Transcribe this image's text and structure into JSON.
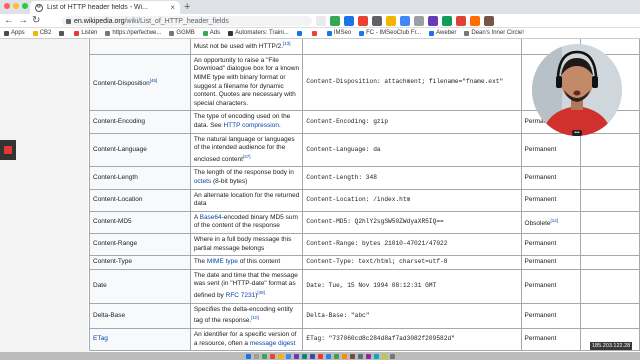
{
  "browser": {
    "tab_title": "List of HTTP header fields - Wi...",
    "favicon_glyph": "W",
    "close_glyph": "×",
    "newtab_glyph": "+",
    "url_host": "en.wikipedia.org",
    "url_path": "/wiki/List_of_HTTP_header_fields",
    "back_glyph": "←",
    "forward_glyph": "→",
    "reload_glyph": "↻"
  },
  "bookmarks": [
    {
      "label": "Apps",
      "color": "#4a4a4a"
    },
    {
      "label": "CB2",
      "color": "#f4b400"
    },
    {
      "label": "",
      "color": "#555"
    },
    {
      "label": "Listen",
      "color": "#e53935"
    },
    {
      "label": "https://perfectwe...",
      "color": "#777"
    },
    {
      "label": "GGMB",
      "color": "#777"
    },
    {
      "label": "Ads",
      "color": "#34a853"
    },
    {
      "label": "Automaters: Traini...",
      "color": "#333"
    },
    {
      "label": "",
      "color": "#1a73e8"
    },
    {
      "label": "",
      "color": "#ea4335"
    },
    {
      "label": "IMSeo",
      "color": "#1a73e8"
    },
    {
      "label": "FC - IMSeoClub Fr...",
      "color": "#1877f2"
    },
    {
      "label": "Aweber",
      "color": "#1a73e8"
    },
    {
      "label": "Dean's Inner Circle!",
      "color": "#777"
    }
  ],
  "rows": [
    {
      "name": "",
      "desc": "Must not be used with HTTP/2.",
      "desc_sup": "[13]",
      "example": "",
      "status": ""
    },
    {
      "name": "Content-Disposition",
      "name_sup": "[46]",
      "desc": "An opportunity to raise a \"File Download\" dialogue box for a known MIME type with binary format or suggest a filename for dynamic content. Quotes are necessary with special characters.",
      "example": "Content-Disposition: attachment; filename=\"fname.ext\"",
      "status": ""
    },
    {
      "name": "Content-Encoding",
      "desc_pre": "The type of encoding used on the data. See ",
      "desc_link": "HTTP compression",
      "desc_post": ".",
      "example": "Content-Encoding: gzip",
      "status": "Permanent"
    },
    {
      "name": "Content-Language",
      "desc": "The natural language or languages of the intended audience for the enclosed content",
      "desc_sup": "[47]",
      "example": "Content-Language: da",
      "status": "Permanent"
    },
    {
      "name": "Content-Length",
      "desc_pre": "The length of the response body in ",
      "desc_link": "octets",
      "desc_post": " (8-bit bytes)",
      "example": "Content-Length: 348",
      "status": "Permanent"
    },
    {
      "name": "Content-Location",
      "desc": "An alternate location for the returned data",
      "example": "Content-Location: /index.htm",
      "status": "Permanent"
    },
    {
      "name": "Content-MD5",
      "desc_pre": "A ",
      "desc_link": "Base64",
      "desc_post": "-encoded binary MD5 sum of the content of the response",
      "example": "Content-MD5: Q2hlY2sgSW50ZWdyaXR5IQ==",
      "status": "Obsolete",
      "status_sup": "[14]"
    },
    {
      "name": "Content-Range",
      "desc": "Where in a full body message this partial message belongs",
      "example": "Content-Range: bytes 21010-47021/47022",
      "status": "Permanent"
    },
    {
      "name": "Content-Type",
      "desc_pre": "The ",
      "desc_link": "MIME type",
      "desc_post": " of this content",
      "example": "Content-Type: text/html; charset=utf-8",
      "status": "Permanent"
    },
    {
      "name": "Date",
      "desc_pre": "The date and time that the message was sent (in \"HTTP-date\" format as defined by ",
      "desc_link": "RFC 7231",
      "desc_post": ")",
      "desc_sup": "[48]",
      "example": "Date: Tue, 15 Nov 1994 08:12:31 GMT",
      "status": "Permanent"
    },
    {
      "name": "Delta-Base",
      "desc": "Specifies the delta-encoding entity tag of the response.",
      "desc_sup": "[10]",
      "example": "Delta-Base: \"abc\"",
      "status": "Permanent"
    },
    {
      "name": "ETag",
      "name_link": true,
      "desc_pre": "An identifier for a specific version of a resource, often a ",
      "desc_link": "message digest",
      "desc_post": "",
      "example": "ETag: \"737060cd8c284d8af7ad3082f209582d\"",
      "status": "Permanent"
    }
  ],
  "overlay": {
    "ip_address": "185.203.122.28",
    "more_glyph": "•••"
  },
  "colors": {
    "link": "#0645ad",
    "record": "#e53935"
  }
}
